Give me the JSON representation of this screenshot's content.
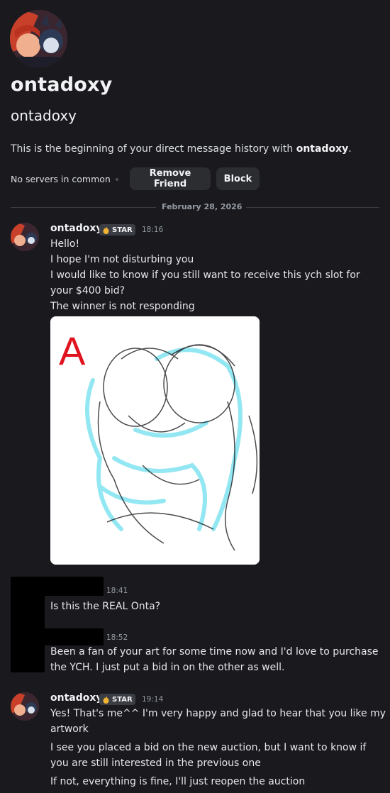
{
  "profile": {
    "display_name": "ontadoxy",
    "username": "ontadoxy",
    "intro_prefix": "This is the beginning of your direct message history with ",
    "intro_name": "ontadoxy",
    "intro_suffix": ".",
    "mutual_servers": "No servers in common",
    "remove_friend_label": "Remove Friend",
    "block_label": "Block"
  },
  "date_divider": "February 28, 2026",
  "messages": [
    {
      "author": "ontadoxy",
      "tag": "STAR",
      "time": "18:16",
      "lines": [
        "Hello!",
        "I hope I'm not disturbing you",
        "I would like to know if you still want to receive this ych slot for",
        "your $400 bid?",
        "The winner is not responding"
      ],
      "attachment_mark": "A"
    },
    {
      "time": "18:41",
      "lines": [
        "Is this the REAL Onta?"
      ]
    },
    {
      "time": "18:52",
      "lines": [
        "Been a fan of your art for some time now and I'd love to purchase",
        "the YCH. I just put a bid in on the other as well."
      ]
    },
    {
      "author": "ontadoxy",
      "tag": "STAR",
      "time": "19:14",
      "lines": [
        "Yes! That's me^^ I'm very happy and glad to hear that you like my",
        "artwork",
        "I see you placed a bid on the new auction, but I want to know if",
        "you are still interested in the previous one",
        "If not, everything is fine, I'll just reopen the auction"
      ]
    }
  ],
  "colors": {
    "background": "#1a1a1e",
    "button": "#2b2d31",
    "muted_text": "#949ba4",
    "accent_red": "#e0141e",
    "sketch_cyan": "#7fe3f0"
  }
}
